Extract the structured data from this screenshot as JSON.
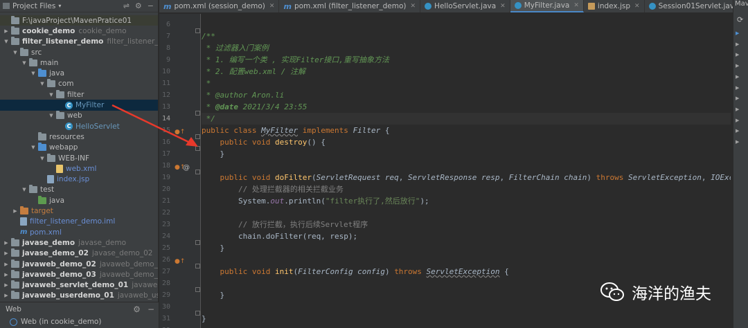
{
  "project_panel": {
    "title": "Project Files",
    "tree": [
      {
        "label": "F:\\javaProject\\MavenPratice01",
        "sub": "",
        "indent": 0,
        "arrow": "",
        "icon": "folder",
        "style": "hl"
      },
      {
        "label": "cookie_demo",
        "sub": "cookie_demo",
        "indent": 0,
        "arrow": "▶",
        "icon": "folder",
        "style": "bold"
      },
      {
        "label": "filter_listener_demo",
        "sub": "filter_listener_demo",
        "indent": 0,
        "arrow": "▼",
        "icon": "folder",
        "style": "bold"
      },
      {
        "label": "src",
        "sub": "",
        "indent": 1,
        "arrow": "▼",
        "icon": "folder",
        "style": ""
      },
      {
        "label": "main",
        "sub": "",
        "indent": 2,
        "arrow": "▼",
        "icon": "folder",
        "style": ""
      },
      {
        "label": "java",
        "sub": "",
        "indent": 3,
        "arrow": "▼",
        "icon": "folder-blue",
        "style": ""
      },
      {
        "label": "com",
        "sub": "",
        "indent": 4,
        "arrow": "▼",
        "icon": "folder",
        "style": ""
      },
      {
        "label": "filter",
        "sub": "",
        "indent": 5,
        "arrow": "▼",
        "icon": "folder",
        "style": ""
      },
      {
        "label": "MyFilter",
        "sub": "",
        "indent": 6,
        "arrow": "",
        "icon": "class",
        "style": "sel"
      },
      {
        "label": "web",
        "sub": "",
        "indent": 5,
        "arrow": "▼",
        "icon": "folder",
        "style": ""
      },
      {
        "label": "HelloServlet",
        "sub": "",
        "indent": 6,
        "arrow": "",
        "icon": "class",
        "style": "blue"
      },
      {
        "label": "resources",
        "sub": "",
        "indent": 3,
        "arrow": "",
        "icon": "folder",
        "style": ""
      },
      {
        "label": "webapp",
        "sub": "",
        "indent": 3,
        "arrow": "▼",
        "icon": "folder-blue",
        "style": ""
      },
      {
        "label": "WEB-INF",
        "sub": "",
        "indent": 4,
        "arrow": "▼",
        "icon": "folder",
        "style": ""
      },
      {
        "label": "web.xml",
        "sub": "",
        "indent": 5,
        "arrow": "",
        "icon": "xml",
        "style": "xml"
      },
      {
        "label": "index.jsp",
        "sub": "",
        "indent": 4,
        "arrow": "",
        "icon": "jsp",
        "style": "xml"
      },
      {
        "label": "test",
        "sub": "",
        "indent": 2,
        "arrow": "▼",
        "icon": "folder",
        "style": ""
      },
      {
        "label": "java",
        "sub": "",
        "indent": 3,
        "arrow": "",
        "icon": "folder-green",
        "style": ""
      },
      {
        "label": "target",
        "sub": "",
        "indent": 1,
        "arrow": "▶",
        "icon": "folder-orange",
        "style": "orange"
      },
      {
        "label": "filter_listener_demo.iml",
        "sub": "",
        "indent": 1,
        "arrow": "",
        "icon": "jsp",
        "style": "xml"
      },
      {
        "label": "pom.xml",
        "sub": "",
        "indent": 1,
        "arrow": "",
        "icon": "m",
        "style": "xml"
      },
      {
        "label": "javase_demo",
        "sub": "javase_demo",
        "indent": 0,
        "arrow": "▶",
        "icon": "folder",
        "style": "bold"
      },
      {
        "label": "javase_demo_02",
        "sub": "javase_demo_02",
        "indent": 0,
        "arrow": "▶",
        "icon": "folder",
        "style": "bold"
      },
      {
        "label": "javaweb_demo_02",
        "sub": "javaweb_demo_02",
        "indent": 0,
        "arrow": "▶",
        "icon": "folder",
        "style": "bold"
      },
      {
        "label": "javaweb_demo_03",
        "sub": "javaweb_demo_03",
        "indent": 0,
        "arrow": "▶",
        "icon": "folder",
        "style": "bold"
      },
      {
        "label": "javaweb_servlet_demo_01",
        "sub": "javaweb_servlet_d",
        "indent": 0,
        "arrow": "▶",
        "icon": "folder",
        "style": "bold"
      },
      {
        "label": "javaweb_userdemo_01",
        "sub": "javaweb_userdemo_0",
        "indent": 0,
        "arrow": "▶",
        "icon": "folder",
        "style": "bold"
      }
    ]
  },
  "web_panel": {
    "title": "Web",
    "item": "Web (in cookie_demo)"
  },
  "tabs": [
    {
      "label": "pom.xml (session_demo)",
      "icon": "m",
      "active": false
    },
    {
      "label": "pom.xml (filter_listener_demo)",
      "icon": "m",
      "active": false
    },
    {
      "label": "HelloServlet.java",
      "icon": "class",
      "active": false
    },
    {
      "label": "MyFilter.java",
      "icon": "class",
      "active": true
    },
    {
      "label": "index.jsp",
      "icon": "jsp",
      "active": false
    },
    {
      "label": "Session01Servlet.java",
      "icon": "class",
      "active": false
    },
    {
      "label": "Session02Servl",
      "icon": "class",
      "active": false
    }
  ],
  "editor": {
    "current_line": 14,
    "line_numbers": [
      "6",
      "7",
      "8",
      "9",
      "10",
      "11",
      "12",
      "13",
      "14",
      "15",
      "16",
      "17",
      "18",
      "19",
      "20",
      "21",
      "22",
      "23",
      "24",
      "25",
      "26",
      "27",
      "28",
      "29",
      "30",
      "31",
      "32"
    ],
    "code": [
      [],
      [
        {
          "c": "cmt",
          "t": "/**"
        }
      ],
      [
        {
          "c": "cmt",
          "t": " * 过滤器入门案例"
        }
      ],
      [
        {
          "c": "cmt",
          "t": " * 1. 编写一个类 , 实现Filter接口,重写抽象方法"
        }
      ],
      [
        {
          "c": "cmt",
          "t": " * 2. 配置web.xml / 注解"
        }
      ],
      [
        {
          "c": "cmt",
          "t": " *"
        }
      ],
      [
        {
          "c": "cmt",
          "t": " * @author Aron.li"
        }
      ],
      [
        {
          "c": "cmt",
          "t": " * "
        },
        {
          "c": "tag",
          "t": "@date"
        },
        {
          "c": "cmt",
          "t": " 2021/3/4 23:55"
        }
      ],
      [
        {
          "c": "cmt",
          "t": " */"
        }
      ],
      [
        {
          "c": "kw",
          "t": "public class "
        },
        {
          "c": "cname",
          "t": "MyFilter"
        },
        {
          "c": "kw",
          "t": " implements "
        },
        {
          "c": "itf",
          "t": "Filter"
        },
        {
          "c": "plain",
          "t": " {"
        }
      ],
      [
        {
          "c": "kw",
          "t": "    public void "
        },
        {
          "c": "fn",
          "t": "destroy"
        },
        {
          "c": "plain",
          "t": "() {"
        }
      ],
      [
        {
          "c": "plain",
          "t": "    }"
        }
      ],
      [],
      [
        {
          "c": "kw",
          "t": "    public void "
        },
        {
          "c": "fn",
          "t": "doFilter"
        },
        {
          "c": "plain",
          "t": "("
        },
        {
          "c": "itf",
          "t": "ServletRequest req"
        },
        {
          "c": "plain",
          "t": ", "
        },
        {
          "c": "itf",
          "t": "ServletResponse resp"
        },
        {
          "c": "plain",
          "t": ", "
        },
        {
          "c": "itf",
          "t": "FilterChain chain"
        },
        {
          "c": "plain",
          "t": ") "
        },
        {
          "c": "kw",
          "t": "throws "
        },
        {
          "c": "itf",
          "t": "ServletException"
        },
        {
          "c": "plain",
          "t": ", "
        },
        {
          "c": "itf",
          "t": "IOExcept"
        }
      ],
      [
        {
          "c": "lcmt",
          "t": "        // 处理拦截器的相关拦截业务"
        }
      ],
      [
        {
          "c": "plain",
          "t": "        System."
        },
        {
          "c": "st",
          "t": "out"
        },
        {
          "c": "plain",
          "t": ".println("
        },
        {
          "c": "str",
          "t": "\"filter执行了,然后放行\""
        },
        {
          "c": "plain",
          "t": ");"
        }
      ],
      [],
      [
        {
          "c": "lcmt",
          "t": "        // 放行拦截，执行后续Servlet程序"
        }
      ],
      [
        {
          "c": "plain",
          "t": "        chain.doFilter(req, resp);"
        }
      ],
      [
        {
          "c": "plain",
          "t": "    }"
        }
      ],
      [],
      [
        {
          "c": "kw",
          "t": "    public void "
        },
        {
          "c": "fn",
          "t": "init"
        },
        {
          "c": "plain",
          "t": "("
        },
        {
          "c": "itf",
          "t": "FilterConfig config"
        },
        {
          "c": "plain",
          "t": ") "
        },
        {
          "c": "kw",
          "t": "throws "
        },
        {
          "c": "itf strike",
          "t": "ServletException"
        },
        {
          "c": "plain",
          "t": " {"
        }
      ],
      [],
      [
        {
          "c": "plain",
          "t": "    }"
        }
      ],
      [],
      [
        {
          "c": "plain",
          "t": "}"
        }
      ],
      []
    ]
  },
  "right_bar": {
    "label": "Mav"
  },
  "watermark": {
    "text": "海洋的渔夫"
  },
  "colors": {
    "background": "#2b2b2b",
    "panel": "#3c3f41",
    "selection": "#0d293e",
    "keyword": "#cc7832",
    "comment": "#629755",
    "arrow": "#e8392b"
  }
}
